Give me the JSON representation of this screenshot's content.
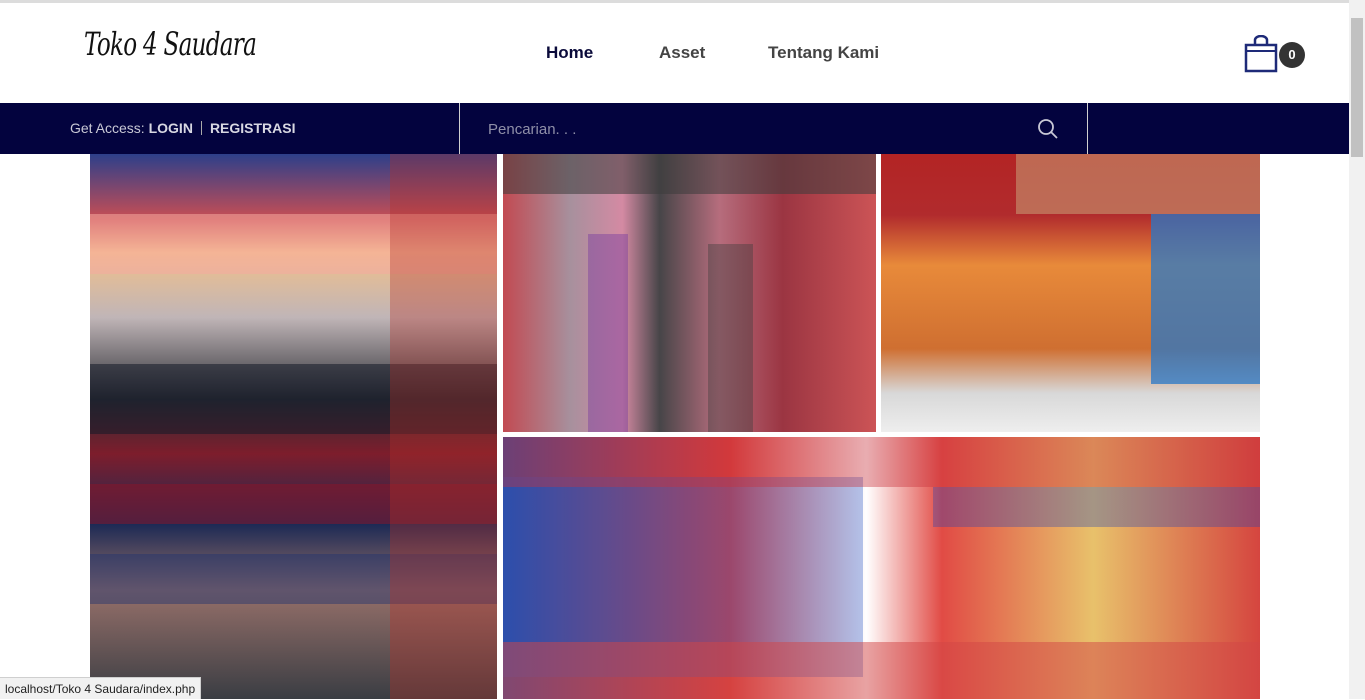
{
  "header": {
    "logo_text": "Toko 4 Saudara",
    "nav": [
      {
        "label": "Home",
        "active": true
      },
      {
        "label": "Asset",
        "active": false
      },
      {
        "label": "Tentang Kami",
        "active": false
      }
    ],
    "cart": {
      "icon": "shopping-bag-icon",
      "count": "0"
    }
  },
  "navbar": {
    "access_prefix": "Get Access:",
    "login_label": "LOGIN",
    "register_label": "REGISTRASI",
    "search": {
      "placeholder": "Pencarian. . .",
      "value": "",
      "icon": "search-icon"
    }
  },
  "gallery": {
    "images": [
      {
        "name": "mattress-stack-photo"
      },
      {
        "name": "rolled-mats-photo"
      },
      {
        "name": "folding-mattress-photo"
      },
      {
        "name": "patterned-mattress-photo"
      }
    ]
  },
  "status_bar": {
    "url": "localhost/Toko 4 Saudara/index.php"
  },
  "colors": {
    "navbar_bg": "#03033e",
    "nav_active": "#0a0a3a",
    "badge_bg": "#333333"
  }
}
